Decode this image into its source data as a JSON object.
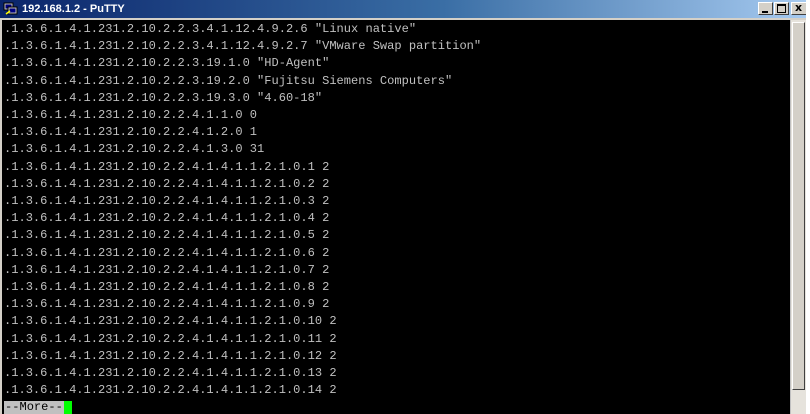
{
  "window": {
    "title": "192.168.1.2 - PuTTY",
    "icon": "putty-computer-icon",
    "buttons": {
      "minimize_icon": "minimize-icon",
      "maximize_icon": "maximize-icon",
      "close_label": "x"
    }
  },
  "terminal": {
    "lines": [
      ".1.3.6.1.4.1.231.2.10.2.2.3.4.1.12.4.9.2.6 \"Linux native\"",
      ".1.3.6.1.4.1.231.2.10.2.2.3.4.1.12.4.9.2.7 \"VMware Swap partition\"",
      ".1.3.6.1.4.1.231.2.10.2.2.3.19.1.0 \"HD-Agent\"",
      ".1.3.6.1.4.1.231.2.10.2.2.3.19.2.0 \"Fujitsu Siemens Computers\"",
      ".1.3.6.1.4.1.231.2.10.2.2.3.19.3.0 \"4.60-18\"",
      ".1.3.6.1.4.1.231.2.10.2.2.4.1.1.0 0",
      ".1.3.6.1.4.1.231.2.10.2.2.4.1.2.0 1",
      ".1.3.6.1.4.1.231.2.10.2.2.4.1.3.0 31",
      ".1.3.6.1.4.1.231.2.10.2.2.4.1.4.1.1.2.1.0.1 2",
      ".1.3.6.1.4.1.231.2.10.2.2.4.1.4.1.1.2.1.0.2 2",
      ".1.3.6.1.4.1.231.2.10.2.2.4.1.4.1.1.2.1.0.3 2",
      ".1.3.6.1.4.1.231.2.10.2.2.4.1.4.1.1.2.1.0.4 2",
      ".1.3.6.1.4.1.231.2.10.2.2.4.1.4.1.1.2.1.0.5 2",
      ".1.3.6.1.4.1.231.2.10.2.2.4.1.4.1.1.2.1.0.6 2",
      ".1.3.6.1.4.1.231.2.10.2.2.4.1.4.1.1.2.1.0.7 2",
      ".1.3.6.1.4.1.231.2.10.2.2.4.1.4.1.1.2.1.0.8 2",
      ".1.3.6.1.4.1.231.2.10.2.2.4.1.4.1.1.2.1.0.9 2",
      ".1.3.6.1.4.1.231.2.10.2.2.4.1.4.1.1.2.1.0.10 2",
      ".1.3.6.1.4.1.231.2.10.2.2.4.1.4.1.1.2.1.0.11 2",
      ".1.3.6.1.4.1.231.2.10.2.2.4.1.4.1.1.2.1.0.12 2",
      ".1.3.6.1.4.1.231.2.10.2.2.4.1.4.1.1.2.1.0.13 2",
      ".1.3.6.1.4.1.231.2.10.2.2.4.1.4.1.1.2.1.0.14 2"
    ],
    "pager_prompt": "--More--",
    "cursor_color": "#00ff00",
    "text_color": "#c0c0c0",
    "background_color": "#000000"
  }
}
